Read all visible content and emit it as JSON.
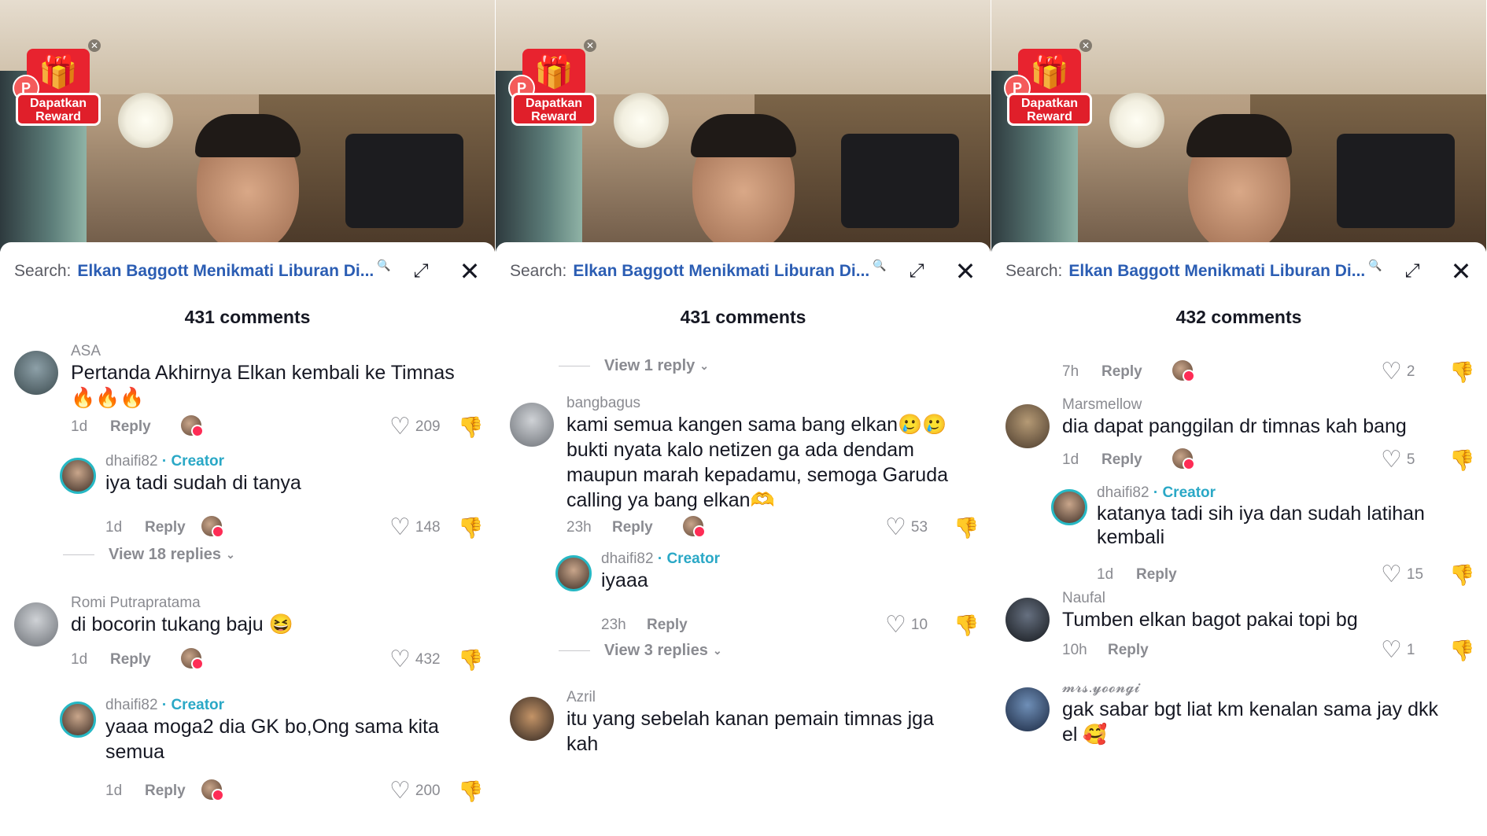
{
  "panels": [
    {
      "search_prefix": "Search:",
      "search_query": "Elkan Baggott Menikmati Liburan Di...",
      "comment_count": "431 comments",
      "reward_label": "Dapatkan Reward",
      "comments": [
        {
          "user": "ASA",
          "text": "Pertanda Akhirnya Elkan kembali ke Timnas 🔥🔥🔥",
          "time": "1d",
          "reply": "Reply",
          "likes": "209"
        },
        {
          "user": "dhaifi82",
          "creator": "· Creator",
          "text": "iya tadi sudah di tanya",
          "time": "1d",
          "reply": "Reply",
          "likes": "148"
        },
        {
          "view": "View 18 replies"
        },
        {
          "user": "Romi Putrapratama",
          "text": "di bocorin tukang baju 😆",
          "time": "1d",
          "reply": "Reply",
          "likes": "432"
        },
        {
          "user": "dhaifi82",
          "creator": "· Creator",
          "text": "yaaa moga2 dia GK bo,Ong sama kita semua",
          "time": "1d",
          "reply": "Reply",
          "likes": "200"
        }
      ]
    },
    {
      "search_prefix": "Search:",
      "search_query": "Elkan Baggott Menikmati Liburan Di...",
      "comment_count": "431 comments",
      "reward_label": "Dapatkan Reward",
      "comments": [
        {
          "view": "View 1 reply"
        },
        {
          "user": "bangbagus",
          "text": "kami semua kangen sama bang elkan🥲🥲 bukti nyata kalo netizen ga ada dendam maupun marah kepadamu, semoga Garuda calling ya bang elkan🫶",
          "time": "23h",
          "reply": "Reply",
          "likes": "53"
        },
        {
          "user": "dhaifi82",
          "creator": "· Creator",
          "text": "iyaaa",
          "time": "23h",
          "reply": "Reply",
          "likes": "10"
        },
        {
          "view": "View 3 replies"
        },
        {
          "user": "Azril",
          "text": "itu yang sebelah kanan pemain timnas jga kah"
        }
      ]
    },
    {
      "search_prefix": "Search:",
      "search_query": "Elkan Baggott Menikmati Liburan Di...",
      "comment_count": "432 comments",
      "reward_label": "Dapatkan Reward",
      "comments": [
        {
          "time": "7h",
          "reply": "Reply",
          "likes": "2"
        },
        {
          "user": "Marsmellow",
          "text": "dia dapat panggilan dr timnas kah bang",
          "time": "1d",
          "reply": "Reply",
          "likes": "5"
        },
        {
          "user": "dhaifi82",
          "creator": "· Creator",
          "text": "katanya tadi sih iya dan sudah latihan kembali",
          "time": "1d",
          "reply": "Reply",
          "likes": "15"
        },
        {
          "user": "Naufal",
          "text": "Tumben elkan bagot pakai topi bg",
          "time": "10h",
          "reply": "Reply",
          "likes": "1"
        },
        {
          "user": "𝓶𝓻𝓼.𝔂𝓸𝓸𝓷𝓰𝓲",
          "text": "gak sabar bgt liat km kenalan sama jay dkk el 🥰"
        }
      ]
    }
  ],
  "icons": {
    "heart": "heart-icon",
    "dislike": "dislike-icon",
    "close": "close-icon",
    "expand": "expand-icon",
    "search": "search-icon"
  }
}
